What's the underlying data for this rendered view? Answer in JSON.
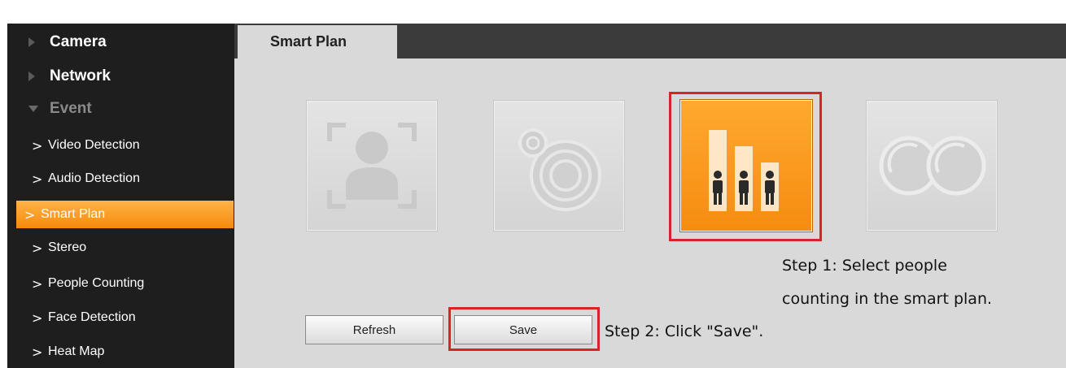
{
  "sidebar": {
    "top_items": [
      {
        "label": "Camera",
        "icon": "triangle-right-icon"
      },
      {
        "label": "Network",
        "icon": "triangle-right-icon"
      },
      {
        "label": "Event",
        "icon": "triangle-down-icon"
      }
    ],
    "event_items": [
      {
        "label": "Video Detection"
      },
      {
        "label": "Audio Detection"
      },
      {
        "label": "Smart Plan",
        "active": true
      },
      {
        "label": "Stereo"
      },
      {
        "label": "People Counting"
      },
      {
        "label": "Face Detection"
      },
      {
        "label": "Heat Map"
      }
    ]
  },
  "tab": {
    "label": "Smart Plan"
  },
  "plans": [
    {
      "name": "face-detection-plan",
      "icon": "face-detect-icon",
      "selected": false
    },
    {
      "name": "heat-map-plan",
      "icon": "heat-map-icon",
      "selected": false
    },
    {
      "name": "people-counting-plan",
      "icon": "people-counting-icon",
      "selected": true
    },
    {
      "name": "stereo-plan",
      "icon": "stereo-icon",
      "selected": false
    }
  ],
  "buttons": {
    "refresh": "Refresh",
    "save": "Save"
  },
  "annotations": {
    "step1_line1": "Step 1: Select people",
    "step1_line2": "counting in the smart plan.",
    "step2": "Step 2: Click \"Save\"."
  },
  "colors": {
    "accent": "#f58c10",
    "highlight": "#d8232a",
    "sidebar_bg": "#1e1e1e",
    "content_bg": "#d9d9d9"
  }
}
